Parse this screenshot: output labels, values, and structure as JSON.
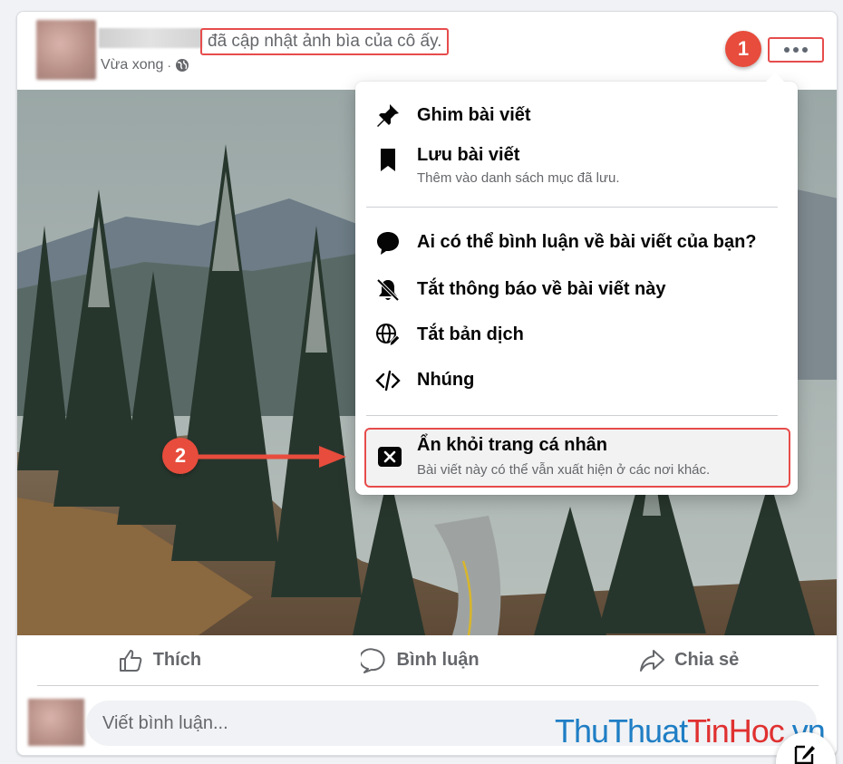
{
  "post": {
    "action_text": "đã cập nhật ảnh bìa của cô ấy.",
    "time": "Vừa xong",
    "separator": "·"
  },
  "icons": {
    "globe": "globe-icon",
    "more": "more-horizontal-icon"
  },
  "badges": {
    "step1": "1",
    "step2": "2"
  },
  "menu": {
    "pin": {
      "title": "Ghim bài viết",
      "icon": "pin-icon"
    },
    "save": {
      "title": "Lưu bài viết",
      "subtitle": "Thêm vào danh sách mục đã lưu.",
      "icon": "bookmark-icon"
    },
    "who_comment": {
      "title": "Ai có thể bình luận về bài viết của bạn?",
      "icon": "comment-bubble-icon"
    },
    "notif_off": {
      "title": "Tắt thông báo về bài viết này",
      "icon": "bell-off-icon"
    },
    "translate_off": {
      "title": "Tắt bản dịch",
      "icon": "globe-edit-icon"
    },
    "embed": {
      "title": "Nhúng",
      "icon": "code-icon"
    },
    "hide": {
      "title": "Ẩn khỏi trang cá nhân",
      "subtitle": "Bài viết này có thể vẫn xuất hiện ở các nơi khác.",
      "icon": "close-box-icon"
    }
  },
  "actions": {
    "like": "Thích",
    "comment": "Bình luận",
    "share": "Chia sẻ"
  },
  "comment_box": {
    "placeholder": "Viết bình luận..."
  },
  "watermark": {
    "part1": "ThuThuat",
    "part2": "TinHoc",
    "part3": ".vn"
  },
  "colors": {
    "highlight": "#e74c4c",
    "badge": "#e74c3c",
    "watermark_blue": "#1f7ec5",
    "watermark_red": "#e03030"
  }
}
